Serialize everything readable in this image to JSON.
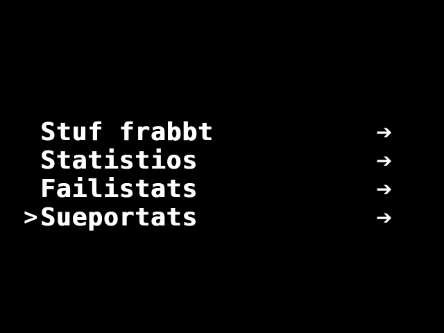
{
  "screen": {
    "background": "#000000",
    "text_color": "#ffffff"
  },
  "menu": {
    "cursor": ">",
    "selected_index": 3,
    "items": [
      {
        "label": "Stuf frabbt",
        "arrow": "➔"
      },
      {
        "label": "Statistios",
        "arrow": "➔"
      },
      {
        "label": "Failistats",
        "arrow": "➔"
      },
      {
        "label": "Sueportats",
        "arrow": "➔"
      }
    ]
  }
}
